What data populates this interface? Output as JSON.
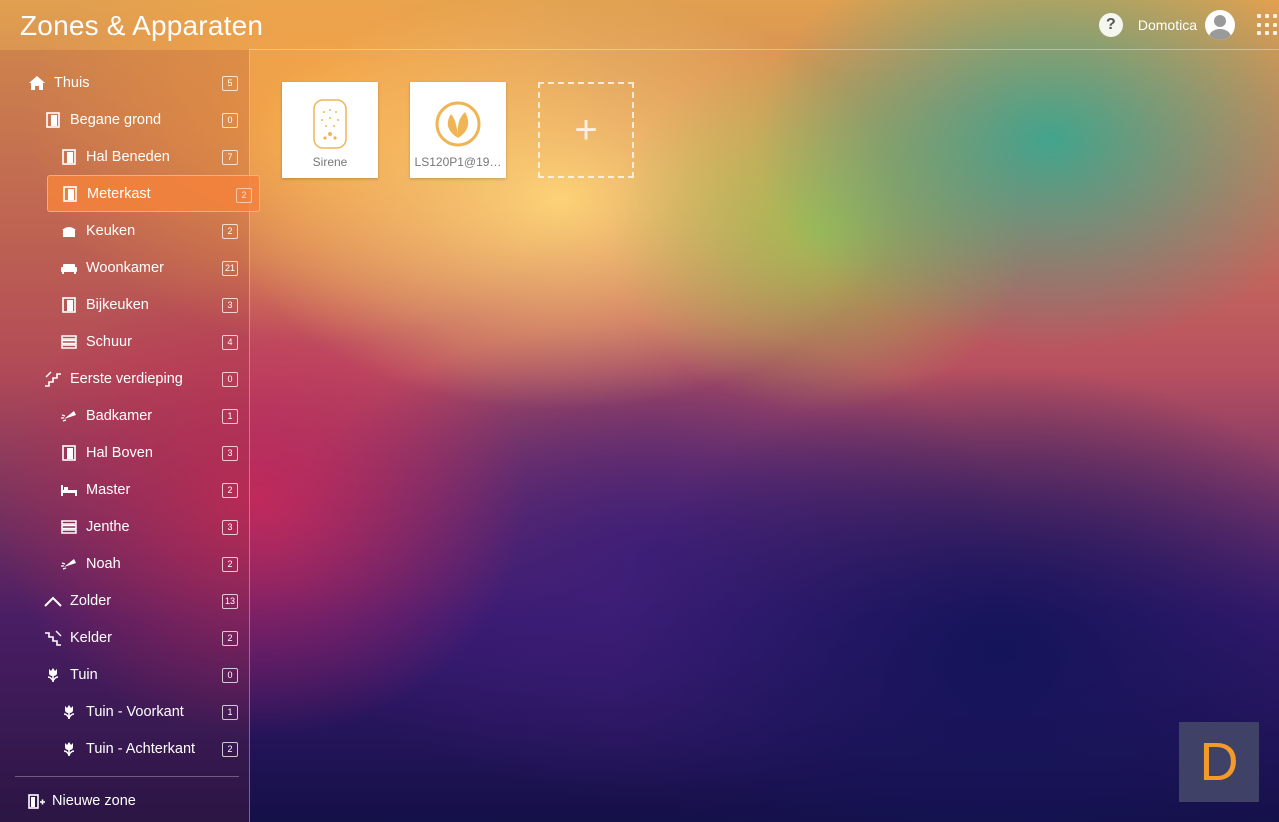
{
  "header": {
    "title": "Zones & Apparaten",
    "help_label": "?",
    "user_name": "Domotica"
  },
  "sidebar": {
    "zones": [
      {
        "label": "Thuis",
        "count": "5",
        "level": 0,
        "icon": "home-icon"
      },
      {
        "label": "Begane grond",
        "count": "0",
        "level": 1,
        "icon": "door-icon"
      },
      {
        "label": "Hal Beneden",
        "count": "7",
        "level": 2,
        "icon": "door-icon"
      },
      {
        "label": "Meterkast",
        "count": "2",
        "level": 2,
        "icon": "door-icon",
        "active": true
      },
      {
        "label": "Keuken",
        "count": "2",
        "level": 2,
        "icon": "kitchen-icon"
      },
      {
        "label": "Woonkamer",
        "count": "21",
        "level": 2,
        "icon": "sofa-icon"
      },
      {
        "label": "Bijkeuken",
        "count": "3",
        "level": 2,
        "icon": "door-icon"
      },
      {
        "label": "Schuur",
        "count": "4",
        "level": 2,
        "icon": "shelves-icon"
      },
      {
        "label": "Eerste verdieping",
        "count": "0",
        "level": 1,
        "icon": "stairs-up-icon"
      },
      {
        "label": "Badkamer",
        "count": "1",
        "level": 2,
        "icon": "shower-icon"
      },
      {
        "label": "Hal Boven",
        "count": "3",
        "level": 2,
        "icon": "door-icon"
      },
      {
        "label": "Master",
        "count": "2",
        "level": 2,
        "icon": "bed-icon"
      },
      {
        "label": "Jenthe",
        "count": "3",
        "level": 2,
        "icon": "shelves-icon"
      },
      {
        "label": "Noah",
        "count": "2",
        "level": 2,
        "icon": "shower-icon"
      },
      {
        "label": "Zolder",
        "count": "13",
        "level": 1,
        "icon": "roof-icon"
      },
      {
        "label": "Kelder",
        "count": "2",
        "level": 1,
        "icon": "stairs-down-icon"
      },
      {
        "label": "Tuin",
        "count": "0",
        "level": 1,
        "icon": "tulip-icon"
      },
      {
        "label": "Tuin - Voorkant",
        "count": "1",
        "level": 2,
        "icon": "tulip-icon"
      },
      {
        "label": "Tuin - Achterkant",
        "count": "2",
        "level": 2,
        "icon": "tulip-icon"
      }
    ],
    "new_zone_label": "Nieuwe zone"
  },
  "devices": [
    {
      "label": "Sirene",
      "icon": "siren-icon"
    },
    {
      "label": "LS120P1@19…",
      "icon": "leaf-icon"
    }
  ],
  "add_device_label": "+",
  "brand_letter": "D",
  "colors": {
    "active_zone": "#f5823c",
    "device_icon": "#f0b455",
    "brand_badge_bg": "#3f4166",
    "brand_letter": "#f39a2a"
  }
}
